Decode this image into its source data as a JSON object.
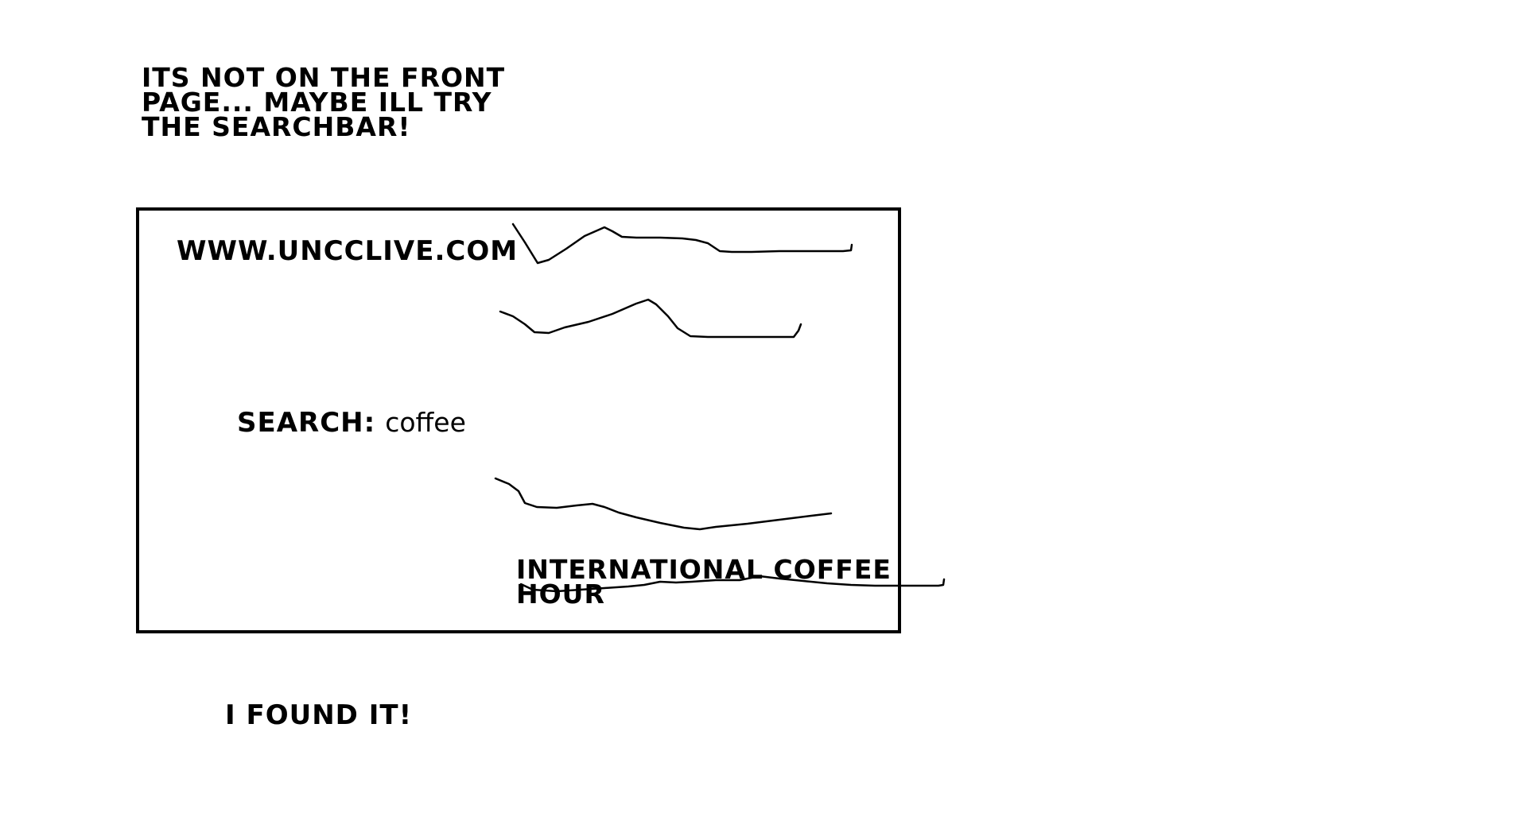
{
  "caption_top": {
    "line1": "ITS NOT ON THE FRONT",
    "line2": "PAGE... MAYBE ILL TRY",
    "line3": "THE SEARCHBAR!"
  },
  "browser_panel": {
    "url": "WWW.UNCCLIVE.COM",
    "search_label": "SEARCH:",
    "search_value": "coffee",
    "result": {
      "line1": "INTERNATIONAL COFFEE",
      "line2": "HOUR"
    }
  },
  "caption_bottom": "I FOUND IT!",
  "colors": {
    "background": "#ffffff",
    "ink": "#000000"
  }
}
